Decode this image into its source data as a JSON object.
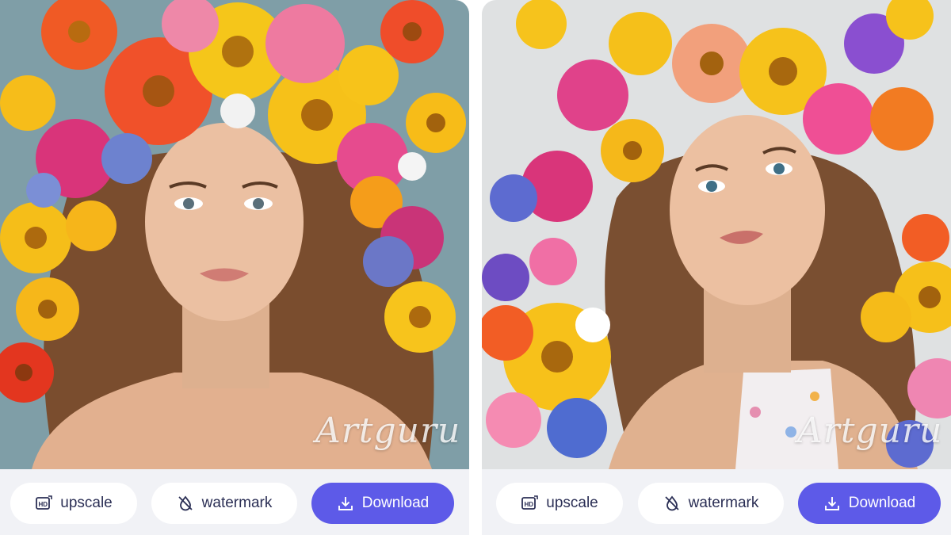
{
  "cards": [
    {
      "watermark": "Artguru",
      "buttons": {
        "upscale": "upscale",
        "watermark": "watermark",
        "download": "Download"
      },
      "background_color": "#7f9ea7"
    },
    {
      "watermark": "Artguru",
      "buttons": {
        "upscale": "upscale",
        "watermark": "watermark",
        "download": "Download"
      },
      "background_color": "#dfe1e2"
    }
  ],
  "colors": {
    "primary": "#5d5ae8",
    "button_bg": "#ffffff",
    "panel_bg": "#f1f2f6",
    "button_text": "#2b2f55"
  },
  "icons": [
    "hd-upscale-icon",
    "no-watermark-icon",
    "download-icon"
  ]
}
